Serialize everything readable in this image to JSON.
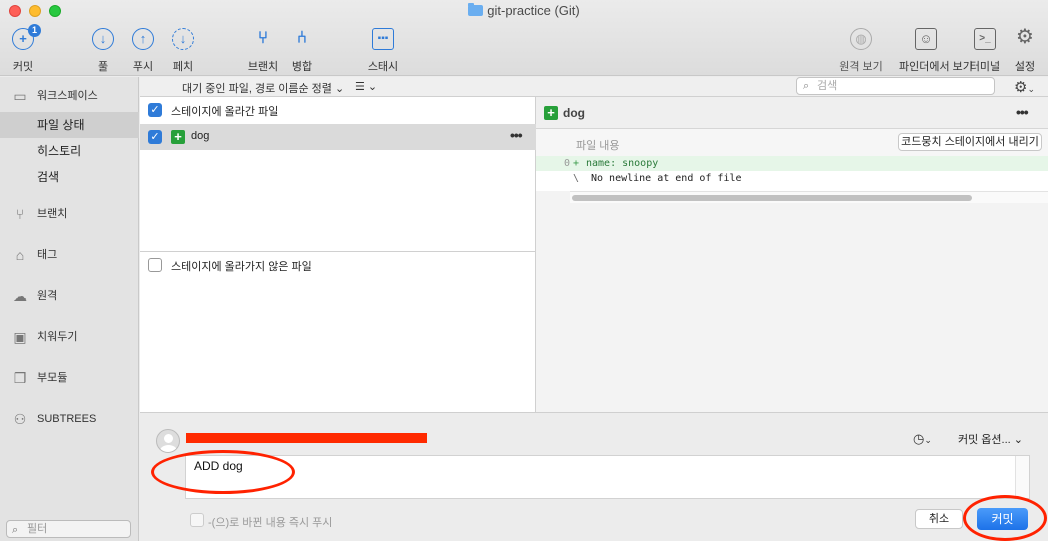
{
  "window": {
    "title": "git-practice (Git)"
  },
  "toolbar": {
    "commit": {
      "label": "커밋",
      "badge": "1"
    },
    "pull": {
      "label": "풀"
    },
    "push": {
      "label": "푸시"
    },
    "fetch": {
      "label": "페치"
    },
    "branch": {
      "label": "브랜치"
    },
    "merge": {
      "label": "병합"
    },
    "stash": {
      "label": "스태시"
    },
    "remote_view": {
      "label": "원격 보기"
    },
    "finder_view": {
      "label": "파인더에서 보기"
    },
    "terminal": {
      "label": "터미널"
    },
    "settings": {
      "label": "설정"
    }
  },
  "sidebar": {
    "workspace": "워크스페이스",
    "file_status": "파일 상태",
    "history": "히스토리",
    "search": "검색",
    "branches": "브랜치",
    "tags": "태그",
    "remotes": "원격",
    "stashes": "치워두기",
    "submodules": "부모듈",
    "subtrees": "SUBTREES",
    "filter_placeholder": "필터"
  },
  "filelist": {
    "sort_label": "대기 중인 파일, 경로 이름순 정렬 ⌄",
    "view_menu": "☰ ⌄",
    "search_placeholder": "검색",
    "staged_header": "스테이지에 올라간 파일",
    "staged_files": [
      {
        "name": "dog",
        "checked": true
      }
    ],
    "unstaged_header": "스테이지에 올라가지 않은 파일"
  },
  "diff": {
    "file": "dog",
    "hunk_title": "파일 내용",
    "unstage_button": "코드뭉치 스테이지에서 내리기",
    "lines": [
      {
        "num": "0",
        "sign": "+",
        "text": "name: snoopy",
        "type": "added"
      },
      {
        "num": "",
        "sign": "\\",
        "text": "No newline at end of file",
        "type": "plain"
      }
    ]
  },
  "commit": {
    "message": "ADD dog",
    "options_label": "커밋 옵션... ⌄",
    "push_option": "-(으)로 바뀐 내용 즉시 푸시",
    "cancel_label": "취소",
    "commit_label": "커밋"
  },
  "colors": {
    "accent": "#2f7bd8",
    "added": "#27a03a",
    "annotation": "#ff2200"
  }
}
